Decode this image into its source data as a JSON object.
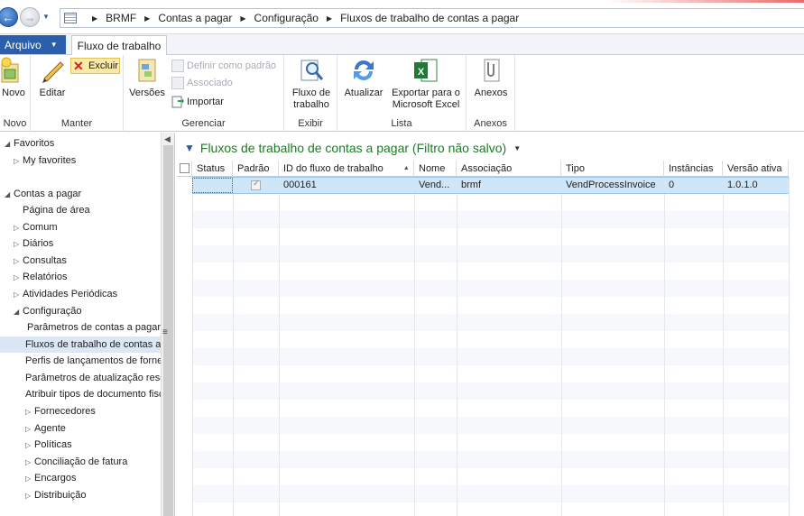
{
  "address_bar": {
    "breadcrumb": [
      "BRMF",
      "Contas a pagar",
      "Configuração",
      "Fluxos de trabalho de contas a pagar"
    ]
  },
  "ribbon": {
    "file_tab": "Arquivo",
    "active_tab": "Fluxo de trabalho",
    "groups": {
      "novo": {
        "label": "Novo",
        "new_button": "Novo"
      },
      "manter": {
        "label": "Manter",
        "edit_button": "Editar",
        "delete_button": "Excluir"
      },
      "gerenciar": {
        "label": "Gerenciar",
        "versions_button": "Versões",
        "set_default_button": "Definir como padrão",
        "associated_button": "Associado",
        "import_button": "Importar"
      },
      "exibir": {
        "label": "Exibir",
        "workflow_button_line1": "Fluxo de",
        "workflow_button_line2": "trabalho"
      },
      "lista": {
        "label": "Lista",
        "refresh_button": "Atualizar",
        "export_line1": "Exportar para o",
        "export_line2": "Microsoft Excel"
      },
      "anexos": {
        "label": "Anexos",
        "attachments_button": "Anexos"
      }
    }
  },
  "nav": {
    "items": [
      {
        "label": "Favoritos",
        "arrow": "◢",
        "indent": 0
      },
      {
        "label": "My favorites",
        "arrow": "▷",
        "indent": 1
      },
      {
        "label": "Contas a pagar",
        "arrow": "◢",
        "indent": 0
      },
      {
        "label": "Página de área",
        "arrow": "",
        "indent": 1
      },
      {
        "label": "Comum",
        "arrow": "▷",
        "indent": 1
      },
      {
        "label": "Diários",
        "arrow": "▷",
        "indent": 1
      },
      {
        "label": "Consultas",
        "arrow": "▷",
        "indent": 1
      },
      {
        "label": "Relatórios",
        "arrow": "▷",
        "indent": 1
      },
      {
        "label": "Atividades Periódicas",
        "arrow": "▷",
        "indent": 1
      },
      {
        "label": "Configuração",
        "arrow": "◢",
        "indent": 1
      },
      {
        "label": "Parâmetros de contas a pagar",
        "arrow": "",
        "indent": 2
      },
      {
        "label": "Fluxos de trabalho de contas a pagar",
        "arrow": "",
        "indent": 2,
        "selected": true
      },
      {
        "label": "Perfis de lançamentos de fornecedor",
        "arrow": "",
        "indent": 2
      },
      {
        "label": "Parâmetros de atualização rescisão",
        "arrow": "",
        "indent": 2
      },
      {
        "label": "Atribuir tipos de documento fiscal",
        "arrow": "",
        "indent": 2
      },
      {
        "label": "Fornecedores",
        "arrow": "▷",
        "indent": 2
      },
      {
        "label": "Agente",
        "arrow": "▷",
        "indent": 2
      },
      {
        "label": "Políticas",
        "arrow": "▷",
        "indent": 2
      },
      {
        "label": "Conciliação de fatura",
        "arrow": "▷",
        "indent": 2
      },
      {
        "label": "Encargos",
        "arrow": "▷",
        "indent": 2
      },
      {
        "label": "Distribuição",
        "arrow": "▷",
        "indent": 2
      }
    ]
  },
  "grid": {
    "title": "Fluxos de trabalho de contas a pagar (Filtro não salvo)",
    "columns": [
      "Status",
      "Padrão",
      "ID do fluxo de trabalho",
      "Nome",
      "Associação",
      "Tipo",
      "Instâncias",
      "Versão ativa"
    ],
    "rows": [
      {
        "status": "",
        "default": true,
        "id": "000161",
        "name": "Vend...",
        "association": "brmf",
        "type": "VendProcessInvoice",
        "instances": "0",
        "active_version": "1.0.1.0"
      }
    ]
  }
}
